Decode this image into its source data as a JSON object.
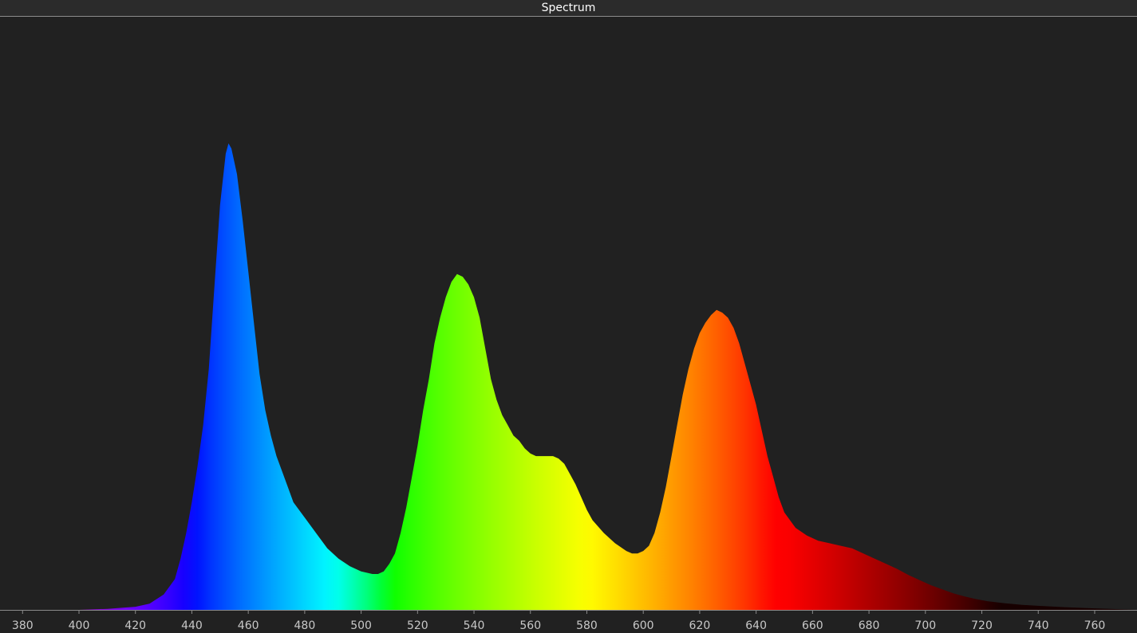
{
  "window": {
    "title": "Spectrum"
  },
  "colors": {
    "background": "#212121",
    "axis": "#8a8a8a",
    "tick_label": "#c8c8c8"
  },
  "chart_data": {
    "type": "area",
    "title": "Spectrum",
    "xlabel": "",
    "ylabel": "",
    "xlim": [
      372,
      775
    ],
    "ylim": [
      0,
      1
    ],
    "grid": false,
    "fill": "wavelength-colored",
    "xticks": [
      380,
      400,
      420,
      440,
      460,
      480,
      500,
      520,
      540,
      560,
      580,
      600,
      620,
      640,
      660,
      680,
      700,
      720,
      740,
      760
    ],
    "points": [
      [
        380,
        0.0
      ],
      [
        400,
        0.0
      ],
      [
        410,
        0.002
      ],
      [
        420,
        0.006
      ],
      [
        425,
        0.012
      ],
      [
        430,
        0.03
      ],
      [
        434,
        0.06
      ],
      [
        436,
        0.1
      ],
      [
        438,
        0.15
      ],
      [
        440,
        0.21
      ],
      [
        442,
        0.28
      ],
      [
        444,
        0.36
      ],
      [
        446,
        0.47
      ],
      [
        448,
        0.63
      ],
      [
        450,
        0.79
      ],
      [
        452,
        0.89
      ],
      [
        453,
        0.91
      ],
      [
        454,
        0.9
      ],
      [
        456,
        0.85
      ],
      [
        458,
        0.76
      ],
      [
        460,
        0.66
      ],
      [
        462,
        0.56
      ],
      [
        464,
        0.46
      ],
      [
        466,
        0.39
      ],
      [
        468,
        0.34
      ],
      [
        470,
        0.3
      ],
      [
        472,
        0.27
      ],
      [
        474,
        0.24
      ],
      [
        476,
        0.21
      ],
      [
        480,
        0.18
      ],
      [
        484,
        0.15
      ],
      [
        488,
        0.12
      ],
      [
        492,
        0.1
      ],
      [
        496,
        0.085
      ],
      [
        500,
        0.075
      ],
      [
        504,
        0.07
      ],
      [
        506,
        0.07
      ],
      [
        508,
        0.075
      ],
      [
        510,
        0.09
      ],
      [
        512,
        0.11
      ],
      [
        514,
        0.15
      ],
      [
        516,
        0.2
      ],
      [
        518,
        0.26
      ],
      [
        520,
        0.32
      ],
      [
        522,
        0.39
      ],
      [
        524,
        0.45
      ],
      [
        526,
        0.52
      ],
      [
        528,
        0.57
      ],
      [
        530,
        0.61
      ],
      [
        532,
        0.64
      ],
      [
        534,
        0.655
      ],
      [
        536,
        0.65
      ],
      [
        538,
        0.635
      ],
      [
        540,
        0.61
      ],
      [
        542,
        0.57
      ],
      [
        544,
        0.51
      ],
      [
        546,
        0.45
      ],
      [
        548,
        0.41
      ],
      [
        550,
        0.38
      ],
      [
        552,
        0.36
      ],
      [
        554,
        0.34
      ],
      [
        556,
        0.33
      ],
      [
        558,
        0.315
      ],
      [
        560,
        0.305
      ],
      [
        562,
        0.3
      ],
      [
        566,
        0.3
      ],
      [
        568,
        0.3
      ],
      [
        570,
        0.295
      ],
      [
        572,
        0.285
      ],
      [
        574,
        0.265
      ],
      [
        576,
        0.245
      ],
      [
        578,
        0.22
      ],
      [
        580,
        0.195
      ],
      [
        582,
        0.175
      ],
      [
        586,
        0.15
      ],
      [
        590,
        0.13
      ],
      [
        594,
        0.115
      ],
      [
        596,
        0.11
      ],
      [
        598,
        0.11
      ],
      [
        600,
        0.115
      ],
      [
        602,
        0.125
      ],
      [
        604,
        0.15
      ],
      [
        606,
        0.19
      ],
      [
        608,
        0.24
      ],
      [
        610,
        0.3
      ],
      [
        612,
        0.36
      ],
      [
        614,
        0.42
      ],
      [
        616,
        0.47
      ],
      [
        618,
        0.51
      ],
      [
        620,
        0.54
      ],
      [
        622,
        0.56
      ],
      [
        624,
        0.575
      ],
      [
        626,
        0.585
      ],
      [
        628,
        0.58
      ],
      [
        630,
        0.57
      ],
      [
        632,
        0.55
      ],
      [
        634,
        0.52
      ],
      [
        636,
        0.48
      ],
      [
        638,
        0.44
      ],
      [
        640,
        0.4
      ],
      [
        642,
        0.35
      ],
      [
        644,
        0.3
      ],
      [
        646,
        0.26
      ],
      [
        648,
        0.22
      ],
      [
        650,
        0.19
      ],
      [
        654,
        0.16
      ],
      [
        658,
        0.145
      ],
      [
        662,
        0.135
      ],
      [
        666,
        0.13
      ],
      [
        670,
        0.125
      ],
      [
        674,
        0.12
      ],
      [
        678,
        0.11
      ],
      [
        682,
        0.1
      ],
      [
        686,
        0.09
      ],
      [
        690,
        0.08
      ],
      [
        694,
        0.068
      ],
      [
        698,
        0.058
      ],
      [
        702,
        0.048
      ],
      [
        706,
        0.04
      ],
      [
        710,
        0.032
      ],
      [
        714,
        0.026
      ],
      [
        718,
        0.021
      ],
      [
        722,
        0.017
      ],
      [
        728,
        0.013
      ],
      [
        734,
        0.01
      ],
      [
        740,
        0.008
      ],
      [
        750,
        0.005
      ],
      [
        760,
        0.003
      ],
      [
        770,
        0.001
      ],
      [
        775,
        0.0
      ]
    ]
  }
}
